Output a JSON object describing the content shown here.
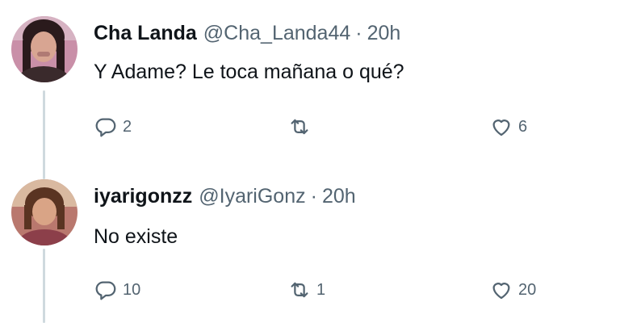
{
  "tweets": [
    {
      "display_name": "Cha Landa",
      "handle": "@Cha_Landa44",
      "separator": "·",
      "time": "20h",
      "text": "Y Adame? Le toca mañana o qué?",
      "reply_count": "2",
      "retweet_count": "",
      "like_count": "6",
      "avatar_colors": {
        "bg": "#c98fa8",
        "skin": "#d8a592",
        "hair": "#2a1a1c"
      },
      "icons": {
        "reply": "reply-icon",
        "retweet": "retweet-icon",
        "like": "heart-icon"
      }
    },
    {
      "display_name": "iyarigonzz",
      "handle": "@IyariGonz",
      "separator": "·",
      "time": "20h",
      "text": "No existe",
      "reply_count": "10",
      "retweet_count": "1",
      "like_count": "20",
      "avatar_colors": {
        "bg": "#b9786e",
        "skin": "#d9a486",
        "hair": "#5a3422"
      },
      "icons": {
        "reply": "reply-icon",
        "retweet": "retweet-icon",
        "like": "heart-icon"
      }
    }
  ],
  "colors": {
    "text_primary": "#0f1419",
    "text_secondary": "#536471",
    "thread_line": "#cfd9de",
    "background": "#ffffff"
  }
}
